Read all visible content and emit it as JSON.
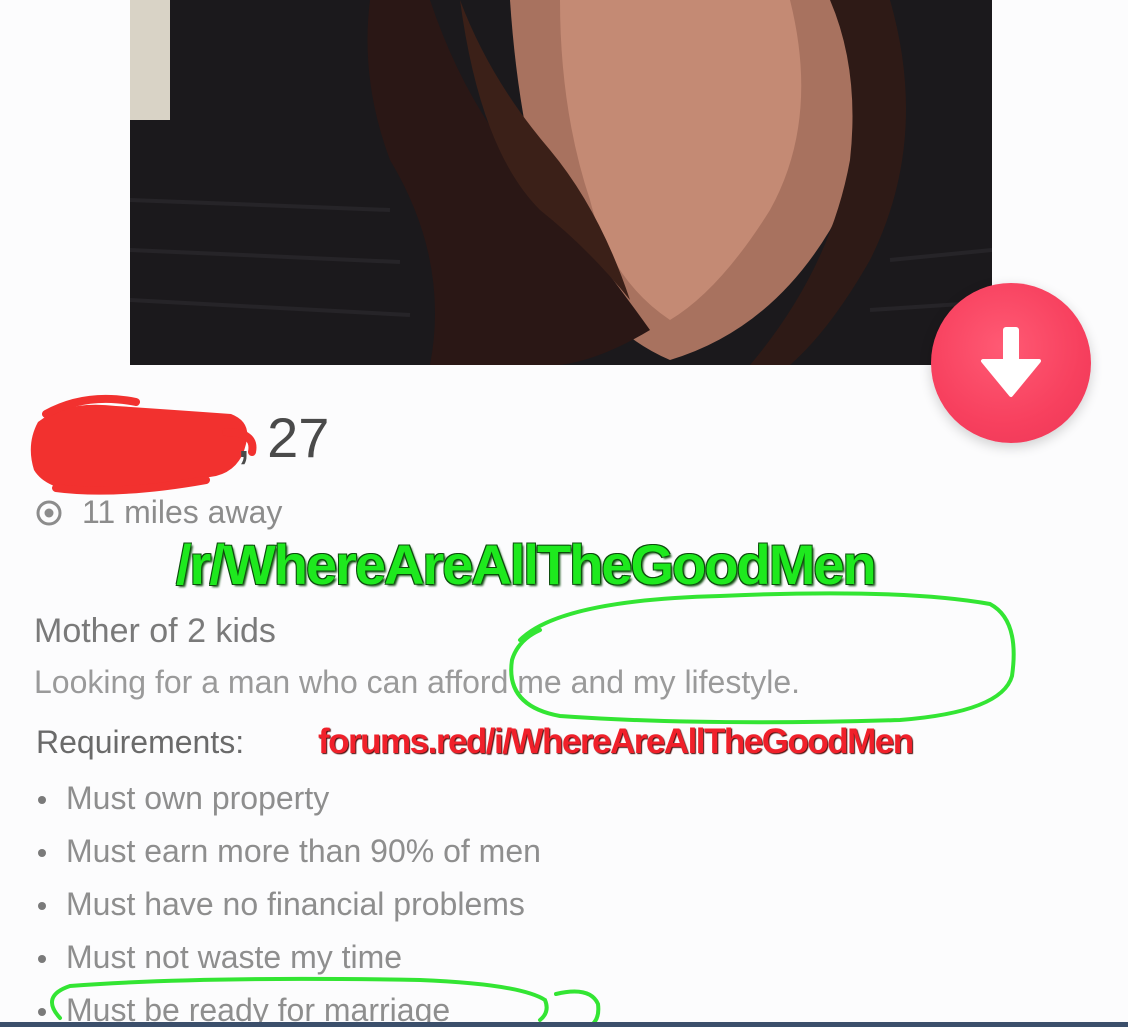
{
  "profile": {
    "age_suffix": ", 27",
    "distance": "11 miles away",
    "bio_line1": "Mother of 2 kids",
    "bio_line2": "Looking for a man who can afford me and my lifestyle.",
    "requirements_label": "Requirements:",
    "requirements": [
      "Must own property",
      "Must earn more than 90% of men",
      "Must have no financial problems",
      "Must not waste my time",
      "Must be ready for marriage"
    ]
  },
  "overlays": {
    "subreddit": "/r/WhereAreAllTheGoodMen",
    "forum_link": "forums.red/i/WhereAreAllTheGoodMen"
  },
  "icons": {
    "down_button": "arrow-down-icon",
    "location": "location-icon"
  },
  "colors": {
    "down_button": "#f7405e",
    "watermark_green": "#1ee91e",
    "watermark_red": "#f0202a",
    "redaction_red": "#f2312f",
    "annotation_ring": "#33e533"
  }
}
